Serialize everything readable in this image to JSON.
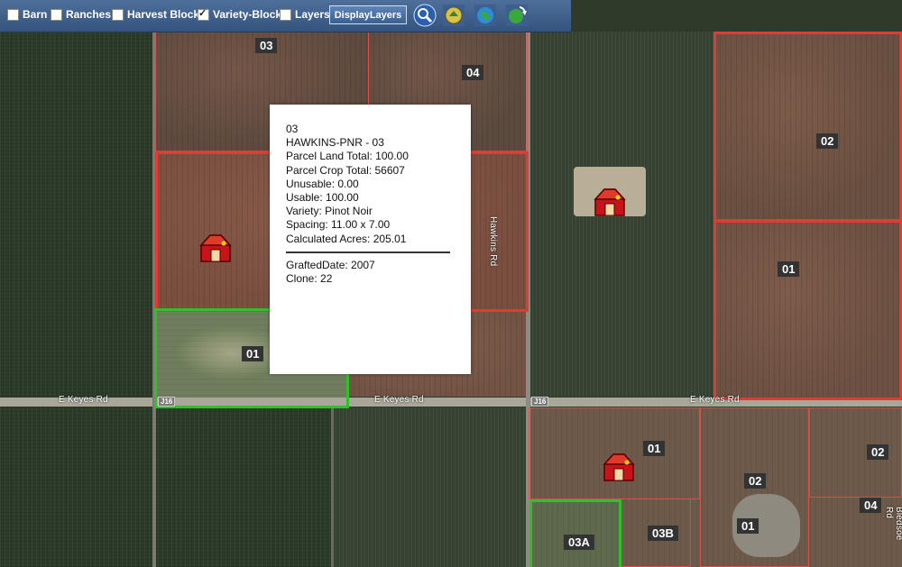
{
  "toolbar": {
    "layers": [
      {
        "label": "Barn",
        "checked": false
      },
      {
        "label": "Ranches",
        "checked": false
      },
      {
        "label": "Harvest Block",
        "checked": false
      },
      {
        "label": "Variety-Block",
        "checked": true
      },
      {
        "label": "Layers",
        "checked": false
      }
    ],
    "display_button": "DisplayLayers",
    "tools": [
      "search-icon",
      "pan-tool-icon",
      "globe-icon",
      "globe-refresh-icon"
    ]
  },
  "block_labels": {
    "l03_top": "03",
    "l04_top": "04",
    "l02_right": "02",
    "l01_right": "01",
    "l01_mid": "01",
    "l01_lower": "01",
    "l02_lower": "02",
    "l02_far": "02",
    "l04_far": "04",
    "l01_bottom": "01",
    "l03b": "03B",
    "l03a": "03A"
  },
  "roads": {
    "keyes_left": "E Keyes Rd",
    "keyes_mid": "E Keyes Rd",
    "keyes_right": "E Keyes Rd",
    "hawkins_rd": "Hawkins Rd",
    "bledsoe_rd": "Bledsoe Rd",
    "route_left": "J16",
    "route_right": "J16"
  },
  "popup": {
    "block_id": "03",
    "name": "HAWKINS-PNR - 03",
    "land_total": "Parcel Land Total: 100.00",
    "crop_total": "Parcel Crop Total: 56607",
    "unusable": "Unusable: 0.00",
    "usable": "Usable: 100.00",
    "variety": "Variety: Pinot Noir",
    "spacing": "Spacing: 11.00 x 7.00",
    "calc_acres": "Calculated Acres: 205.01",
    "grafted": "GraftedDate: 2007",
    "clone": "Clone: 22"
  },
  "colors": {
    "variety_block_border": "#e23b36",
    "selected_block_border": "#2ec22a",
    "toolbar": "#3e5f8a"
  }
}
